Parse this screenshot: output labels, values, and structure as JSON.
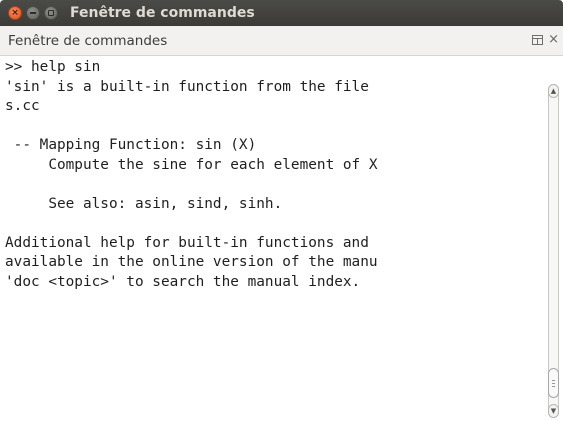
{
  "window": {
    "title": "Fenêtre de commandes"
  },
  "dock": {
    "title": "Fenêtre de commandes",
    "close_glyph": "×"
  },
  "console": {
    "lines": [
      ">> help sin",
      "'sin' is a built-in function from the file",
      "s.cc",
      "",
      " -- Mapping Function: sin (X)",
      "     Compute the sine for each element of X",
      "",
      "     See also: asin, sind, sinh.",
      "",
      "Additional help for built-in functions and",
      "available in the online version of the manu",
      "'doc <topic>' to search the manual index."
    ]
  },
  "icons": {
    "close": "close-icon",
    "minimize": "minimize-icon",
    "maximize": "maximize-icon",
    "undock": "undock-icon",
    "dock_close": "close-icon",
    "scroll_up": "chevron-up-icon",
    "scroll_down": "chevron-down-icon"
  },
  "colors": {
    "titlebar": "#3c3b37",
    "title_text": "#dfdbd2",
    "close_button": "#e04f1b",
    "dockbar": "#f2f1f0",
    "console_bg": "#ffffff",
    "console_text": "#1f1f1f"
  }
}
